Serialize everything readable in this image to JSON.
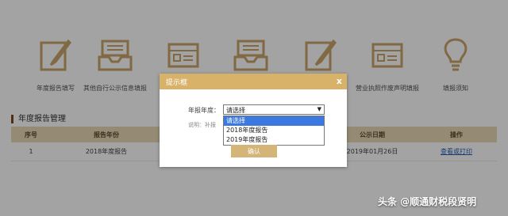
{
  "icons": [
    {
      "label": "年度报告填写",
      "icon": "pencil-doc-icon"
    },
    {
      "label": "其他自行公示信息填报",
      "icon": "inbox-tray-icon"
    },
    {
      "label": "",
      "icon": "form-card-icon"
    },
    {
      "label": "",
      "icon": "inbox-tray-icon"
    },
    {
      "label": "",
      "icon": "pencil-doc-icon"
    },
    {
      "label": "营业执照作废声明填报",
      "icon": "form-card-icon"
    },
    {
      "label": "填报须知",
      "icon": "lightbulb-icon"
    }
  ],
  "section": {
    "title": "年度报告管理"
  },
  "table": {
    "headers": [
      "序号",
      "报告年份",
      "公示日期",
      "操作"
    ],
    "rows": [
      {
        "index": "1",
        "year": "2018年度报告",
        "date": "2019年01月26日",
        "action": "查看或打印"
      }
    ]
  },
  "dialog": {
    "title": "提示框",
    "close": "x",
    "field_label": "年报年度：",
    "select_value": "请选择",
    "options": [
      "请选择",
      "2018年度报告",
      "2019年度报告"
    ],
    "note": "说明：补报",
    "confirm": "确认"
  },
  "watermark": "头条 @顺通财税段贤明",
  "colors": {
    "accent": "#d9b26a",
    "table_header": "#e9d9b8",
    "icon": "#c9a46a",
    "link": "#2a5db0"
  }
}
